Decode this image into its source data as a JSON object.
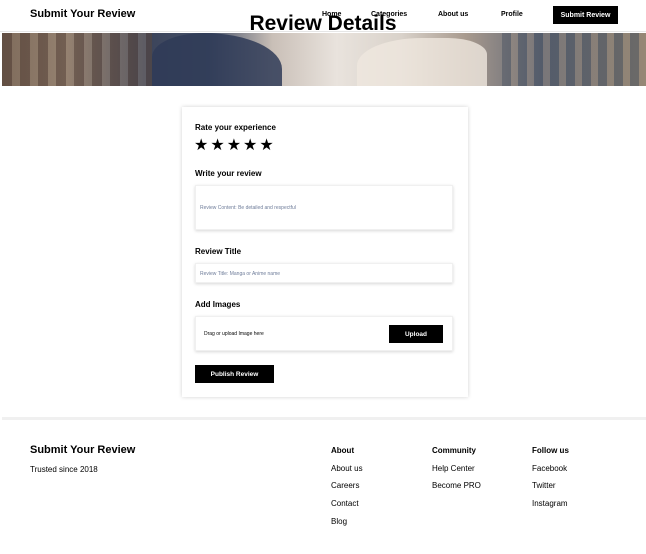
{
  "header": {
    "brand": "Submit Your Review",
    "nav": [
      "Home",
      "Categories",
      "About us",
      "Profile"
    ],
    "cta": "Submit Review"
  },
  "hero": {
    "title": "Review Details"
  },
  "form": {
    "rating_label": "Rate your experience",
    "rating_stars": 5,
    "stars": [
      "★",
      "★",
      "★",
      "★",
      "★"
    ],
    "review_label": "Write your review",
    "review_placeholder": "Review Content: Be detailed and respectful",
    "title_label": "Review Title",
    "title_placeholder": "Review Title: Manga or Anime name",
    "images_label": "Add Images",
    "upload_text": "Drag or upload Image here",
    "upload_button": "Upload",
    "publish_button": "Publish Review"
  },
  "footer": {
    "brand": "Submit Your Review",
    "since": "Trusted since 2018",
    "columns": [
      {
        "title": "About",
        "links": [
          "About us",
          "Careers",
          "Contact",
          "Blog"
        ]
      },
      {
        "title": "Community",
        "links": [
          "Help Center",
          "Become PRO"
        ]
      },
      {
        "title": "Follow us",
        "links": [
          "Facebook",
          "Twitter",
          "Instagram"
        ]
      }
    ]
  },
  "colors": {
    "accent": "#000000",
    "background": "#ffffff",
    "placeholder": "#6f7d9a"
  }
}
